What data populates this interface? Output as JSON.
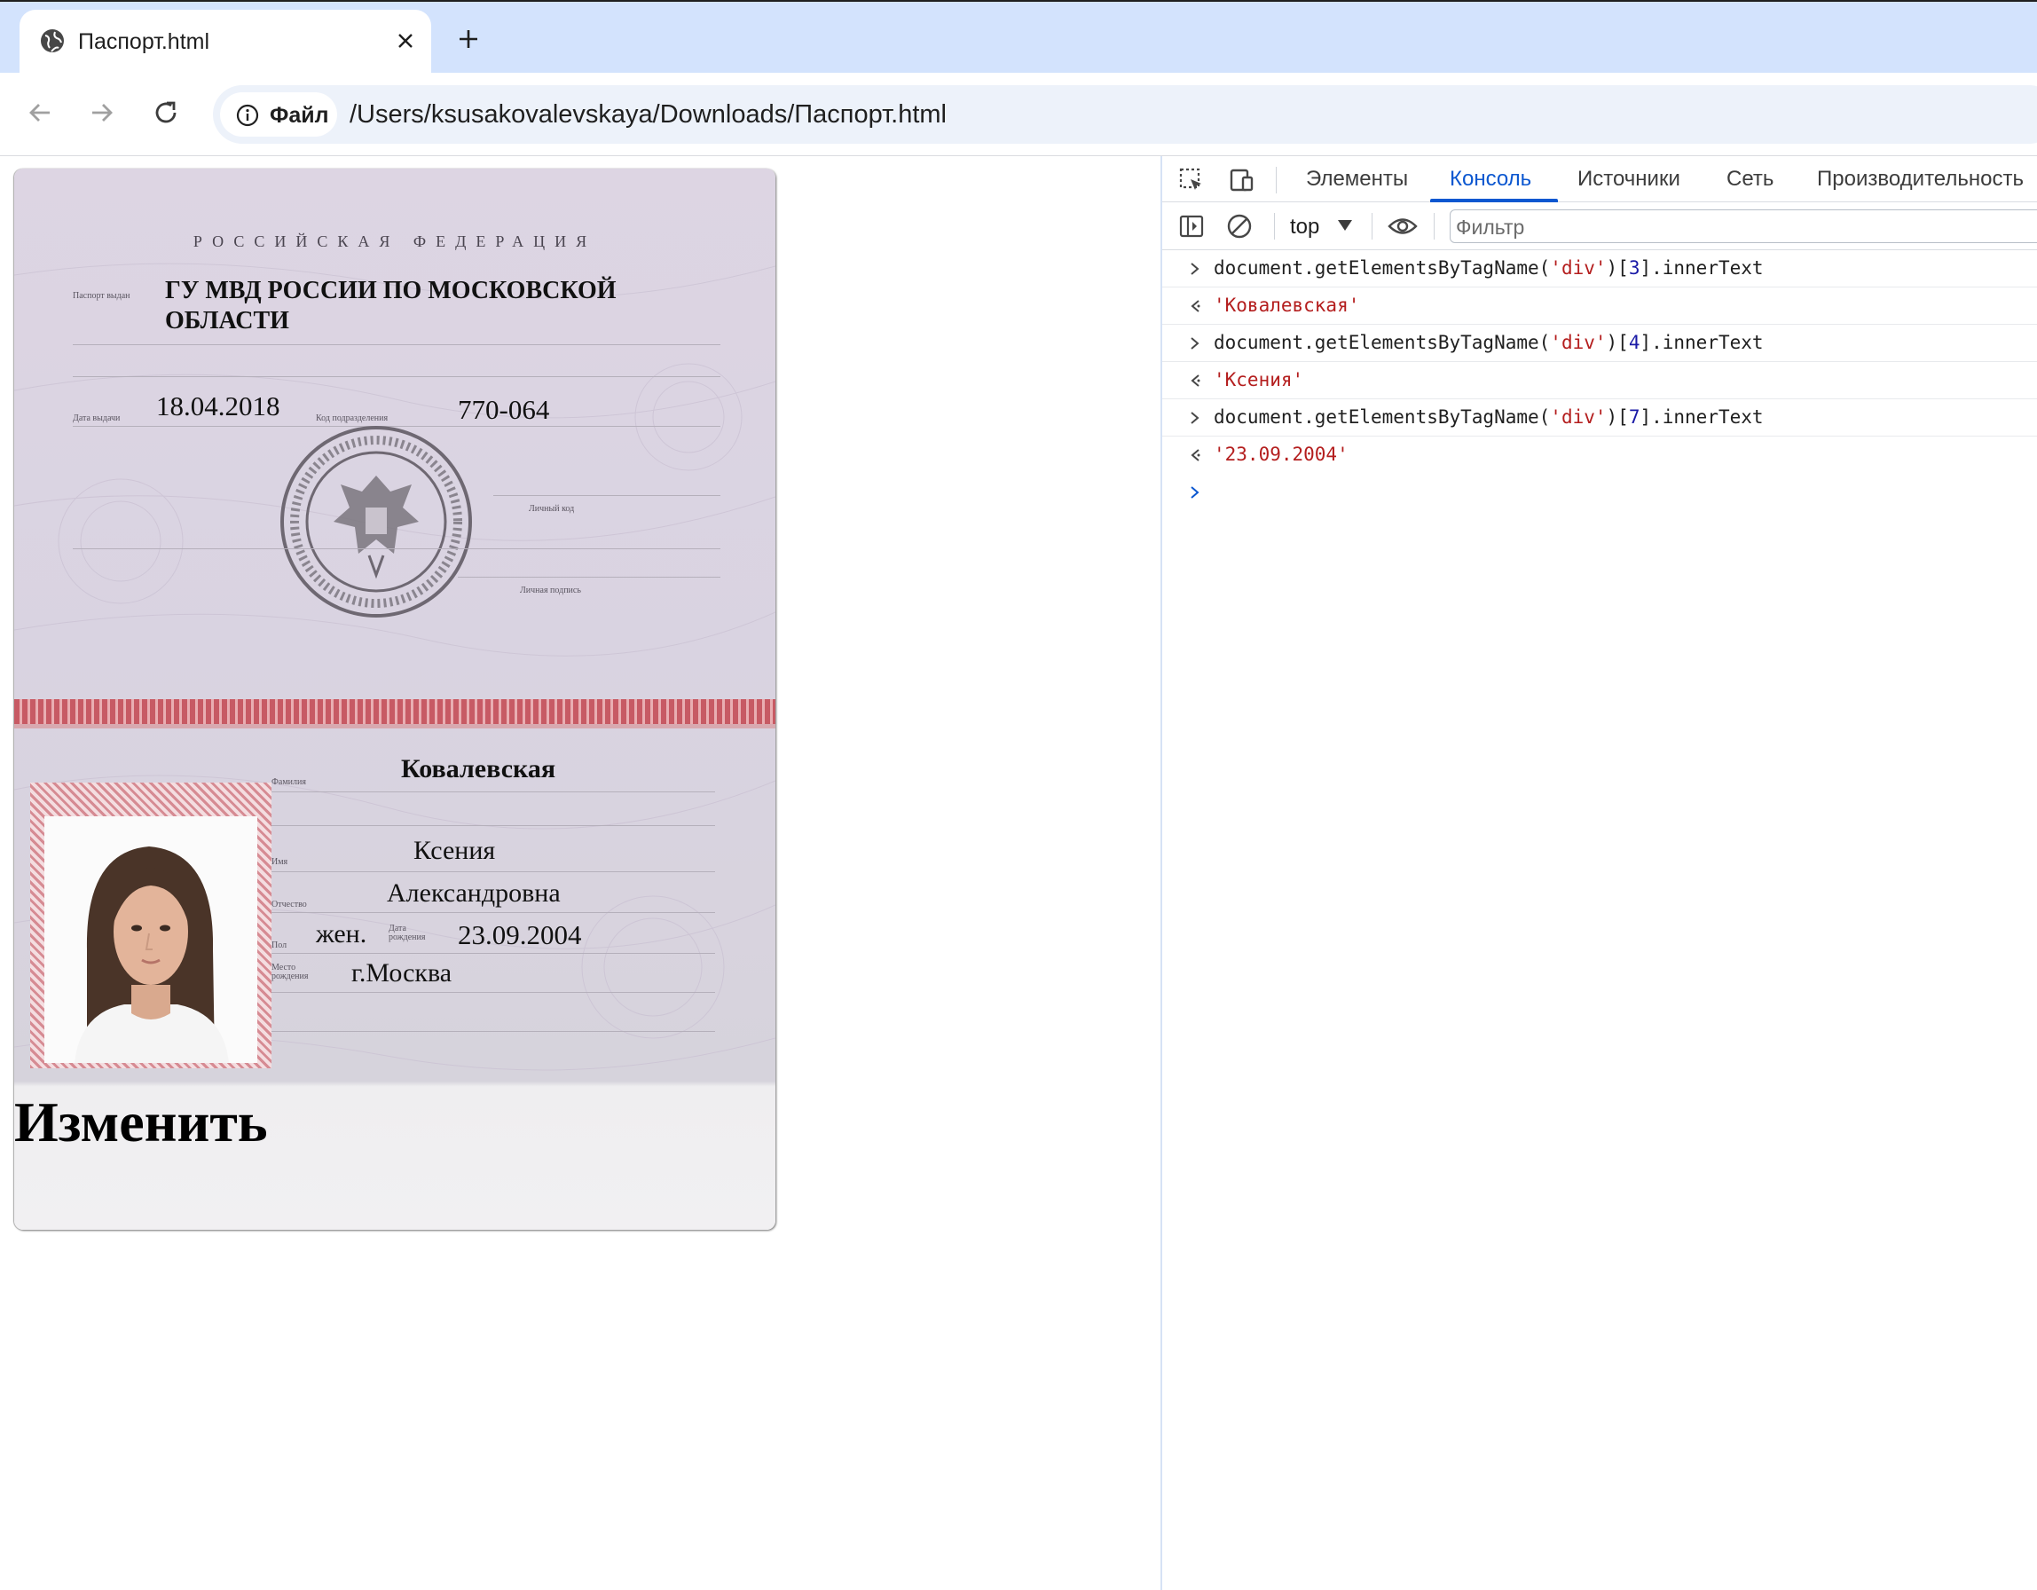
{
  "browser": {
    "tab_title": "Паспорт.html",
    "site_chip_label": "Файл",
    "url": "/Users/ksusakovalevskaya/Downloads/Паспорт.html"
  },
  "passport": {
    "header": "РОССИЙСКАЯ ФЕДЕРАЦИЯ",
    "issued_by_label": "Паспорт выдан",
    "issued_by_line1": "ГУ МВД РОССИИ ПО МОСКОВСКОЙ",
    "issued_by_line2": "ОБЛАСТИ",
    "issue_date_label": "Дата выдачи",
    "issue_date": "18.04.2018",
    "division_code_label": "Код подразделения",
    "division_code": "770-064",
    "personal_code_label": "Личный код",
    "signature_label": "Личная подпись",
    "surname_label": "Фамилия",
    "surname": "Ковалевская",
    "name_label": "Имя",
    "name": "Ксения",
    "patronymic_label": "Отчество",
    "patronymic": "Александровна",
    "sex_label": "Пол",
    "sex": "жен.",
    "birth_date_label": "Дата рождения",
    "birth_date": "23.09.2004",
    "birth_place_label": "Место рождения",
    "birth_place": "г.Москва",
    "edit_label": "Изменить"
  },
  "devtools": {
    "tabs": [
      "Элементы",
      "Консоль",
      "Источники",
      "Сеть",
      "Производительность"
    ],
    "active_tab": "Консоль",
    "context": "top",
    "filter_placeholder": "Фильтр",
    "console": [
      {
        "kind": "input",
        "prefix": "document.getElementsByTagName(",
        "arg": "'div'",
        "mid": ")[",
        "index": "3",
        "suffix": "].innerText"
      },
      {
        "kind": "output",
        "value": "'Ковалевская'"
      },
      {
        "kind": "input",
        "prefix": "document.getElementsByTagName(",
        "arg": "'div'",
        "mid": ")[",
        "index": "4",
        "suffix": "].innerText"
      },
      {
        "kind": "output",
        "value": "'Ксения'"
      },
      {
        "kind": "input",
        "prefix": "document.getElementsByTagName(",
        "arg": "'div'",
        "mid": ")[",
        "index": "7",
        "suffix": "].innerText"
      },
      {
        "kind": "output",
        "value": "'23.09.2004'"
      }
    ]
  },
  "colors": {
    "accent": "#0b57d0",
    "tabbar": "#d3e3fd",
    "console_string": "#b41e1e",
    "console_number": "#1a1aa6"
  }
}
